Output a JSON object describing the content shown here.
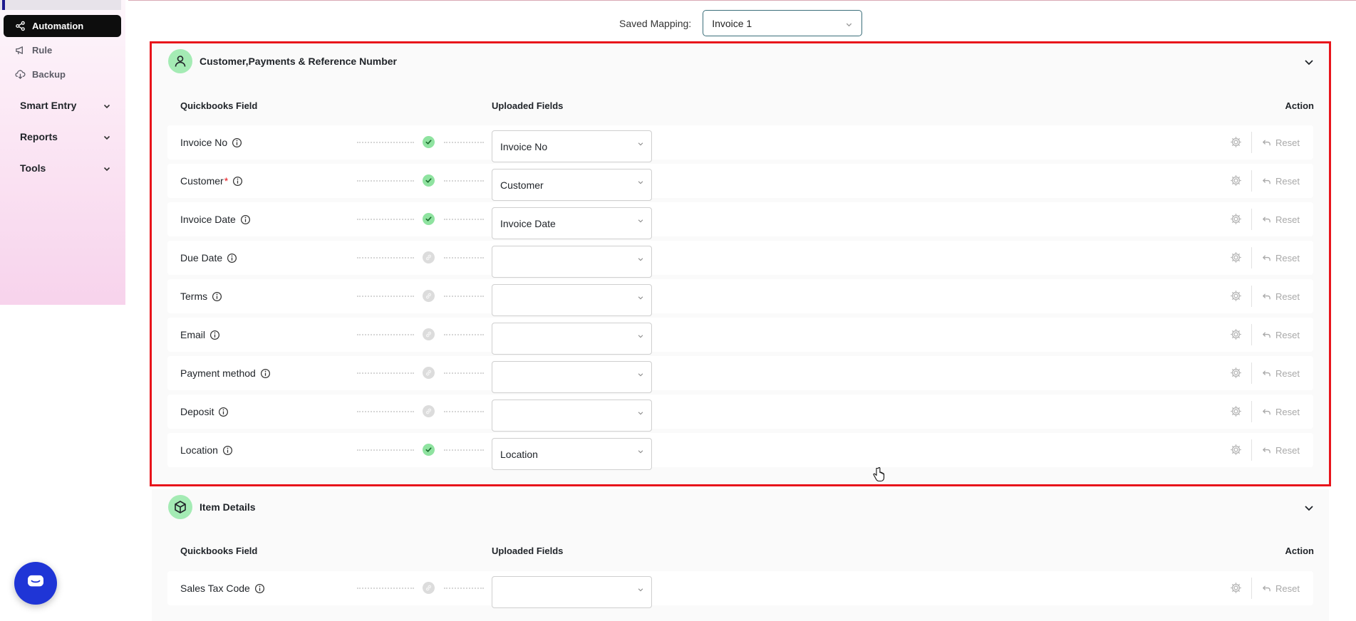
{
  "sidebar": {
    "items": [
      {
        "label": "Automation",
        "icon": "share-nodes-icon",
        "active": true
      },
      {
        "label": "Rule",
        "icon": "megaphone-icon",
        "active": false
      },
      {
        "label": "Backup",
        "icon": "cloud-download-icon",
        "active": false
      }
    ],
    "groups": [
      {
        "label": "Smart Entry",
        "icon": "chevron-down-icon"
      },
      {
        "label": "Reports",
        "icon": "chevron-down-icon"
      },
      {
        "label": "Tools",
        "icon": "chevron-down-icon"
      }
    ]
  },
  "saved_mapping": {
    "label": "Saved Mapping:",
    "value": "Invoice 1"
  },
  "sections": [
    {
      "title": "Customer,Payments & Reference Number",
      "icon": "user-icon",
      "columns": {
        "field": "Quickbooks Field",
        "uploaded": "Uploaded Fields",
        "action": "Action"
      },
      "rows": [
        {
          "field": "Invoice No",
          "required": false,
          "mapped": true,
          "value": "Invoice No",
          "reset": "Reset"
        },
        {
          "field": "Customer",
          "required": true,
          "mapped": true,
          "value": "Customer",
          "reset": "Reset"
        },
        {
          "field": "Invoice Date",
          "required": false,
          "mapped": true,
          "value": "Invoice Date",
          "reset": "Reset"
        },
        {
          "field": "Due Date",
          "required": false,
          "mapped": false,
          "value": "",
          "reset": "Reset"
        },
        {
          "field": "Terms",
          "required": false,
          "mapped": false,
          "value": "",
          "reset": "Reset"
        },
        {
          "field": "Email",
          "required": false,
          "mapped": false,
          "value": "",
          "reset": "Reset"
        },
        {
          "field": "Payment method",
          "required": false,
          "mapped": false,
          "value": "",
          "reset": "Reset"
        },
        {
          "field": "Deposit",
          "required": false,
          "mapped": false,
          "value": "",
          "reset": "Reset"
        },
        {
          "field": "Location",
          "required": false,
          "mapped": true,
          "value": "Location",
          "reset": "Reset"
        }
      ]
    },
    {
      "title": "Item Details",
      "icon": "box-icon",
      "columns": {
        "field": "Quickbooks Field",
        "uploaded": "Uploaded Fields",
        "action": "Action"
      },
      "rows": [
        {
          "field": "Sales Tax Code",
          "required": false,
          "mapped": false,
          "value": "",
          "reset": "Reset"
        }
      ]
    }
  ],
  "colors": {
    "accent_green": "#8fe3a0",
    "highlight_red": "#e8141b",
    "chat_blue": "#1f35d6",
    "active_nav": "#0d0d0d"
  }
}
